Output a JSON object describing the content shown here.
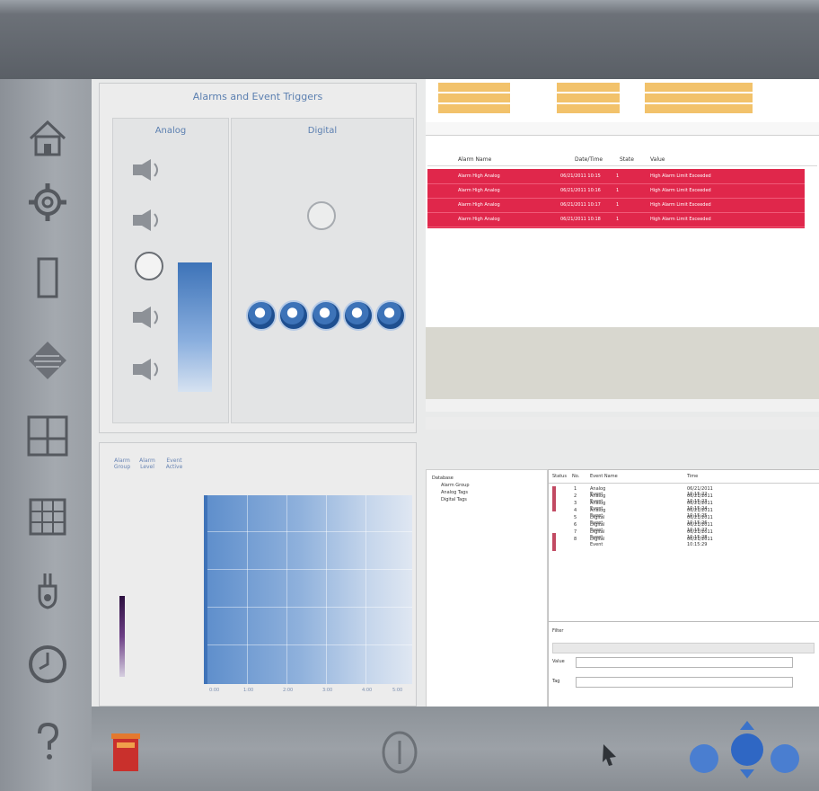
{
  "colors": {
    "accent_blue": "#3d73b8",
    "alarm_red": "#e0274b",
    "legend_orange": "#f2c26b"
  },
  "nav_icons": [
    "home-icon",
    "gear-icon",
    "device-icon",
    "layers-icon",
    "dashboard-icon",
    "grid-icon",
    "tools-icon",
    "clock-icon",
    "help-icon"
  ],
  "alarm_panel": {
    "title": "Alarms and Event Triggers",
    "analog_label": "Analog",
    "digital_label": "Digital"
  },
  "chart_panel": {
    "col_labels": [
      "Alarm Group",
      "Alarm Level",
      "Event Active"
    ],
    "tick_labels": [
      "0:00",
      "1:00",
      "2:00",
      "3:00",
      "4:00",
      "5:00"
    ]
  },
  "alarm_list": {
    "headers": [
      "Alarm Name",
      "Date/Time",
      "State",
      "Value"
    ],
    "rows": [
      [
        "Alarm High Analog",
        "06/21/2011 10:15",
        "1",
        "High Alarm Limit Exceeded"
      ],
      [
        "Alarm High Analog",
        "06/21/2011 10:16",
        "1",
        "High Alarm Limit Exceeded"
      ],
      [
        "Alarm High Analog",
        "06/21/2011 10:17",
        "1",
        "High Alarm Limit Exceeded"
      ],
      [
        "Alarm High Analog",
        "06/21/2011 10:18",
        "1",
        "High Alarm Limit Exceeded"
      ]
    ]
  },
  "tree": {
    "items": [
      "Database",
      "Alarm Group",
      "Analog Tags",
      "Digital Tags"
    ]
  },
  "event_grid": {
    "headers": [
      "Status",
      "No.",
      "Event Name",
      "Time"
    ],
    "rows": [
      [
        "",
        "1",
        "Analog Event",
        "06/21/2011 10:15:22"
      ],
      [
        "",
        "2",
        "Analog Event",
        "06/21/2011 10:15:23"
      ],
      [
        "",
        "3",
        "Analog Event",
        "06/21/2011 10:15:24"
      ],
      [
        "",
        "4",
        "Analog Event",
        "06/21/2011 10:15:25"
      ],
      [
        "",
        "5",
        "Digital Event",
        "06/21/2011 10:15:26"
      ],
      [
        "",
        "6",
        "Digital Event",
        "06/21/2011 10:15:27"
      ],
      [
        "",
        "7",
        "Digital Event",
        "06/21/2011 10:15:28"
      ],
      [
        "",
        "8",
        "Digital Event",
        "06/21/2011 10:15:29"
      ]
    ],
    "fields": [
      "Filter",
      "Value",
      "Tag"
    ]
  }
}
